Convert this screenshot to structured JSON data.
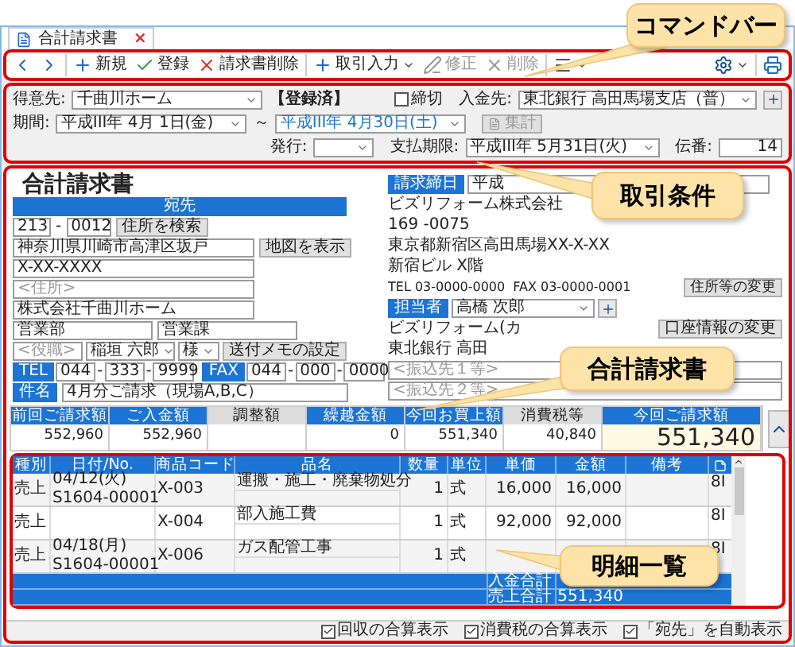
{
  "tab": {
    "label": "合計請求書",
    "close": "×"
  },
  "command_bar": {
    "left": [
      [
        {
          "kind": "prev",
          "dropdown": false,
          "disabled": false
        },
        {
          "kind": "next",
          "dropdown": false,
          "disabled": false
        }
      ],
      [
        {
          "kind": "plus",
          "label": "新規",
          "dropdown": false,
          "disabled": false
        },
        {
          "kind": "check",
          "label": "登録",
          "dropdown": false,
          "disabled": false
        },
        {
          "kind": "cross",
          "label": "請求書削除",
          "dropdown": false,
          "disabled": false
        }
      ],
      [
        {
          "kind": "plus",
          "label": "取引入力",
          "dropdown": true,
          "disabled": false
        },
        {
          "kind": "pen",
          "label": "修正",
          "dropdown": false,
          "disabled": true
        },
        {
          "kind": "cross",
          "label": "削除",
          "dropdown": false,
          "disabled": true
        }
      ],
      [
        {
          "kind": "menu",
          "dropdown": true,
          "disabled": false
        }
      ]
    ],
    "right": [
      [
        {
          "kind": "gear",
          "dropdown": true,
          "disabled": false
        }
      ],
      [
        {
          "kind": "print",
          "dropdown": false,
          "disabled": false
        }
      ]
    ]
  },
  "callouts": [
    {
      "text": "コマンドバー"
    },
    {
      "text": "取引条件"
    },
    {
      "text": "合計請求書"
    },
    {
      "text": "明細一覧"
    }
  ],
  "conditions": {
    "customer": {
      "label": "得意先:",
      "value": "千曲川ホーム"
    },
    "status": "【登録済】",
    "closing": {
      "label": "締切",
      "checked": false
    },
    "deposit": {
      "label": "入金先:",
      "value": "東北銀行 高田馬場支店（普）"
    },
    "period": {
      "label": "期間:",
      "from": "平成III年 4月 1日(金)",
      "separator": "～",
      "to": "平成III年 4月30日(土)"
    },
    "tally": {
      "label": "集計",
      "disabled": true
    },
    "issue": {
      "label": "発行:"
    },
    "due": {
      "label": "支払期限:",
      "value": "平成III年 5月31日(火)"
    },
    "slip": {
      "label": "伝番:",
      "value": "14"
    }
  },
  "invoice": {
    "title": "合計請求書",
    "recipient": {
      "header": "宛先",
      "postal": [
        "213",
        "0012"
      ],
      "postal_separator": "-",
      "search_button": "住所を検索",
      "address1": "神奈川県川崎市高津区坂戸",
      "map_button": "地図を表示",
      "address2": "X-XX-XXXX",
      "address3_placeholder": "<住所>",
      "company": "株式会社千曲川ホーム",
      "department": "営業部",
      "section": "営業課",
      "position_placeholder": "<役職>",
      "person": "稲垣 六郎",
      "honorific": "様",
      "memo_button": "送付メモの設定",
      "tel": {
        "label": "TEL",
        "parts": [
          "044",
          "333",
          "9999"
        ]
      },
      "fax": {
        "label": "FAX",
        "parts": [
          "044",
          "000",
          "0000"
        ]
      },
      "phone_separator": "-",
      "subject": {
        "label": "件名",
        "value": "4月分ご請求（現場A,B,C）"
      }
    },
    "issuer": {
      "closing_date": {
        "label": "請求締日",
        "value": "平成"
      },
      "lines": [
        "ビズリフォーム株式会社",
        "169 -0075",
        "東京都新宿区高田馬場XX-X-XX",
        "新宿ビル X階"
      ],
      "tel": "TEL 03-0000-0000",
      "fax": "FAX 03-0000-0001",
      "address_button": "住所等の変更",
      "staff": {
        "label": "担当者",
        "value": "高橋 次郎"
      },
      "bank_name": "ビズリフォーム(カ",
      "bank_button": "口座情報の変更",
      "bank_branch": "東北銀行 高田",
      "transfer_placeholders": [
        "<振込先１等>",
        "<振込先２等>"
      ]
    }
  },
  "summary": [
    {
      "label": "前回ご請求額",
      "value": "552,960",
      "kind": "amount"
    },
    {
      "label": "ご入金額",
      "value": "552,960",
      "kind": "amount"
    },
    {
      "label": "調整額",
      "kind": "manual"
    },
    {
      "label": "繰越金額",
      "value": "0",
      "kind": "amount"
    },
    {
      "label": "今回お買上額",
      "value": "551,340",
      "kind": "amount"
    },
    {
      "label": "消費税等",
      "value": "40,840",
      "kind": "manual"
    },
    {
      "label": "今回ご請求額",
      "value": "551,340",
      "kind": "total"
    }
  ],
  "details": {
    "columns": [
      "種別",
      "日付/No.",
      "商品コード",
      "品名",
      "数量",
      "単位",
      "単価",
      "金額",
      "備考"
    ],
    "rows": [
      {
        "type": "売上",
        "date": "04/12(火)",
        "number": "S1604-00001",
        "code": "X-003",
        "name": "運搬・施工・廃棄物処分",
        "qty": "1",
        "unit": "式",
        "price": "16,000",
        "amount": "16,000",
        "tax": "8I"
      },
      {
        "type": "売上",
        "code": "X-004",
        "name": "部入施工費",
        "qty": "1",
        "unit": "式",
        "price": "92,000",
        "amount": "92,000",
        "tax": "8I"
      },
      {
        "type": "売上",
        "date": "04/18(月)",
        "number": "S1604-00001",
        "code": "X-006",
        "name": "ガス配管工事",
        "qty": "1",
        "unit": "式",
        "tax": "8I"
      }
    ],
    "footer": [
      {
        "label": "入金合計"
      },
      {
        "label": "売上合計",
        "value": "551,340"
      }
    ]
  },
  "options": [
    {
      "label": "回収の合算表示",
      "checked": true
    },
    {
      "label": "消費税の合算表示",
      "checked": true
    },
    {
      "label": "「宛先」を自動表示",
      "checked": true
    }
  ]
}
